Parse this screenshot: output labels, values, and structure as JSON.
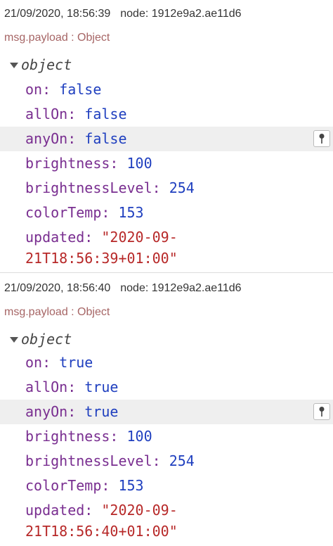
{
  "messages": [
    {
      "timestamp": "21/09/2020, 18:56:39",
      "node": "node: 1912e9a2.ae11d6",
      "topic": "msg.payload : Object",
      "root_label": "object",
      "props": {
        "on": {
          "key": "on",
          "value": "false"
        },
        "allOn": {
          "key": "allOn",
          "value": "false"
        },
        "anyOn": {
          "key": "anyOn",
          "value": "false"
        },
        "brightness": {
          "key": "brightness",
          "value": "100"
        },
        "brightnessLevel": {
          "key": "brightnessLevel",
          "value": "254"
        },
        "colorTemp": {
          "key": "colorTemp",
          "value": "153"
        },
        "updated": {
          "key": "updated",
          "value_line1": "\"2020-09-",
          "value_line2": "21T18:56:39+01:00\""
        }
      },
      "pin_icon": "pin-icon"
    },
    {
      "timestamp": "21/09/2020, 18:56:40",
      "node": "node: 1912e9a2.ae11d6",
      "topic": "msg.payload : Object",
      "root_label": "object",
      "props": {
        "on": {
          "key": "on",
          "value": "true"
        },
        "allOn": {
          "key": "allOn",
          "value": "true"
        },
        "anyOn": {
          "key": "anyOn",
          "value": "true"
        },
        "brightness": {
          "key": "brightness",
          "value": "100"
        },
        "brightnessLevel": {
          "key": "brightnessLevel",
          "value": "254"
        },
        "colorTemp": {
          "key": "colorTemp",
          "value": "153"
        },
        "updated": {
          "key": "updated",
          "value_line1": "\"2020-09-",
          "value_line2": "21T18:56:40+01:00\""
        }
      },
      "pin_icon": "pin-icon"
    }
  ],
  "colors": {
    "key": "#792e90",
    "boolean": "#1f3fbf",
    "number": "#1f3fbf",
    "string": "#b72828",
    "topic": "#a66565",
    "highlight_row": "#efefef"
  }
}
